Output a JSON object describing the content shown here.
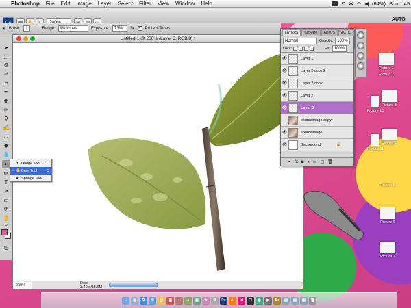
{
  "menubar": {
    "app": "Photoshop",
    "items": [
      "File",
      "Edit",
      "Image",
      "Layer",
      "Select",
      "Filter",
      "View",
      "Window",
      "Help"
    ],
    "battery": "(64%)",
    "clock": "Sun 1:45"
  },
  "options": {
    "zoom": "200%",
    "workspace": "AUTO",
    "brush_label": "Brush:",
    "brush_size": "1",
    "range_label": "Range:",
    "range_value": "Midtones",
    "exposure_label": "Exposure:",
    "exposure_value": "73%",
    "protect_tones": "Protect Tones"
  },
  "document": {
    "title": "Untitled-1 @ 200% (Layer 3, RGB/8) *",
    "zoom": "200%",
    "doc_size": "Doc: 3.49M/15.6M"
  },
  "tool_flyout": {
    "items": [
      {
        "label": "Dodge Tool",
        "key": "O"
      },
      {
        "label": "Burn Tool",
        "key": "O"
      },
      {
        "label": "Sponge Tool",
        "key": "O"
      }
    ]
  },
  "layers_panel": {
    "tabs": [
      "LAYERS",
      "CHANNI",
      "ADJUS",
      "ACTIO"
    ],
    "blend_mode": "Normal",
    "opacity_label": "Opacity:",
    "opacity": "100%",
    "lock_label": "Lock:",
    "fill_label": "Fill:",
    "fill": "100%",
    "layers": [
      {
        "name": "Layer 1",
        "selected": false,
        "thumb": "transparent"
      },
      {
        "name": "Layer 2 copy 2",
        "selected": false,
        "thumb": "transparent"
      },
      {
        "name": "Layer 2 copy",
        "selected": false,
        "thumb": "transparent"
      },
      {
        "name": "Layer 2",
        "selected": false,
        "thumb": "transparent"
      },
      {
        "name": "Layer 3",
        "selected": true,
        "thumb": "transparent"
      },
      {
        "name": "sourceimage copy",
        "selected": false,
        "thumb": "photo"
      },
      {
        "name": "sourceimage",
        "selected": false,
        "thumb": "photo"
      },
      {
        "name": "Background",
        "selected": false,
        "thumb": "white"
      }
    ]
  },
  "desktop_icons": [
    "Picture 1",
    "Picture 2",
    "Picture 10",
    "Picture 3",
    "Picture 11",
    "Picture 4",
    "Picture 5",
    "Picture 6",
    "Picture 7"
  ],
  "colors": {
    "selection": "#b06fc8",
    "foreground": "#e85aa0",
    "accent_blue": "#3a6bd6"
  }
}
